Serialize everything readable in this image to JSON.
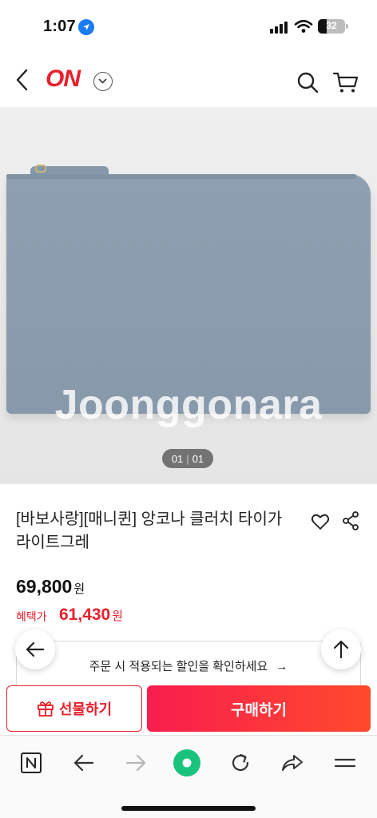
{
  "status_bar": {
    "time": "1:07",
    "battery": "32"
  },
  "header": {
    "logo": "ON"
  },
  "gallery": {
    "watermark": "Joonggonara",
    "current_page": "01",
    "separator": "|",
    "total_pages": "01"
  },
  "product": {
    "title": "[바보사랑][매니퀸] 앙코나 클러치 타이가 라이트그레",
    "price": "69,800",
    "price_unit": "원",
    "benefit_label": "혜택가",
    "benefit_price": "61,430",
    "benefit_unit": "원"
  },
  "notice": {
    "text": "주문 시 적용되는 할인을 확인하세요",
    "arrow": "→"
  },
  "cta": {
    "gift_label": "선물하기",
    "buy_label": "구매하기"
  },
  "colors": {
    "brand_red": "#e8202c",
    "buy_gradient_start": "#f81d4e",
    "buy_gradient_end": "#ff4a2b",
    "browser_green": "#19c37d"
  },
  "icons": {
    "back": "chevron-left-icon",
    "logo_menu": "chevron-down-icon",
    "search": "search-icon",
    "cart": "cart-icon",
    "like": "heart-icon",
    "share": "share-icon",
    "float_back": "arrow-left-icon",
    "scroll_top": "arrow-up-icon",
    "gift": "gift-icon",
    "browser": [
      "naver-n-icon",
      "arrow-left-icon",
      "arrow-right-icon",
      "green-dot-icon",
      "refresh-icon",
      "share-arrow-icon",
      "menu-icon"
    ]
  }
}
